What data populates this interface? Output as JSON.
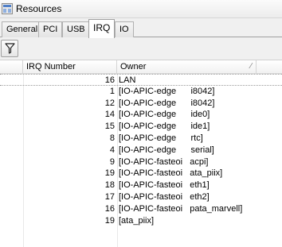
{
  "window": {
    "title": "Resources"
  },
  "tabs": [
    {
      "label": "General"
    },
    {
      "label": "PCI"
    },
    {
      "label": "USB"
    },
    {
      "label": "IRQ"
    },
    {
      "label": "IO"
    }
  ],
  "active_tab": "IRQ",
  "toolbar": {
    "filter_icon": "filter-icon"
  },
  "table": {
    "columns": [
      "",
      "IRQ Number",
      "Owner"
    ],
    "rows": [
      {
        "irq": "16",
        "owner": "LAN"
      },
      {
        "irq": "1",
        "owner": "[IO-APIC-edge      i8042]"
      },
      {
        "irq": "12",
        "owner": "[IO-APIC-edge      i8042]"
      },
      {
        "irq": "14",
        "owner": "[IO-APIC-edge      ide0]"
      },
      {
        "irq": "15",
        "owner": "[IO-APIC-edge      ide1]"
      },
      {
        "irq": "8",
        "owner": "[IO-APIC-edge      rtc]"
      },
      {
        "irq": "4",
        "owner": "[IO-APIC-edge      serial]"
      },
      {
        "irq": "9",
        "owner": "[IO-APIC-fasteoi   acpi]"
      },
      {
        "irq": "19",
        "owner": "[IO-APIC-fasteoi   ata_piix]"
      },
      {
        "irq": "18",
        "owner": "[IO-APIC-fasteoi   eth1]"
      },
      {
        "irq": "17",
        "owner": "[IO-APIC-fasteoi   eth2]"
      },
      {
        "irq": "16",
        "owner": "[IO-APIC-fasteoi   pata_marvell]"
      },
      {
        "irq": "19",
        "owner": "[ata_piix]"
      }
    ]
  },
  "colors": {
    "title_text": "#000000",
    "grid_line": "#d5d5d5"
  }
}
